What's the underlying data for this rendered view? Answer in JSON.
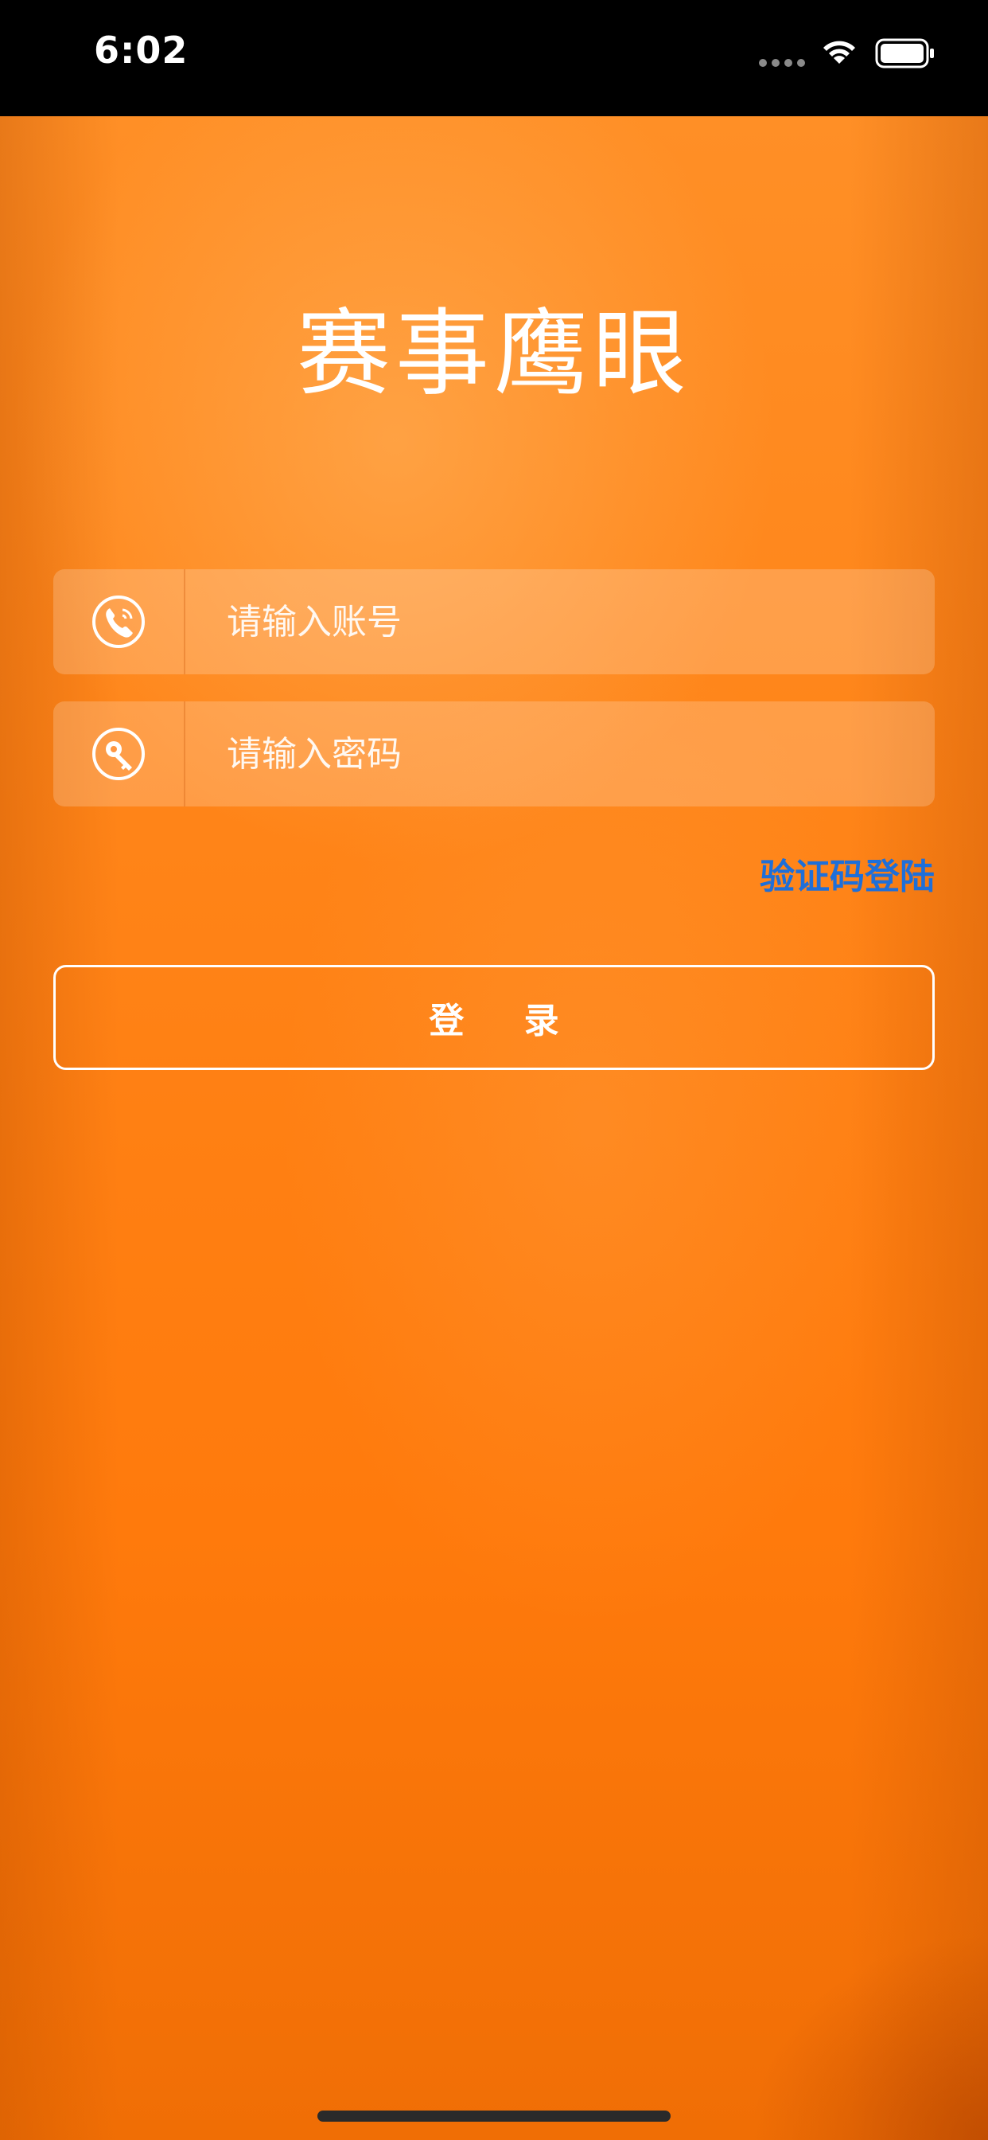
{
  "status_bar": {
    "time": "6:02",
    "icons": [
      "signal-dots-icon",
      "wifi-icon",
      "battery-icon"
    ]
  },
  "app": {
    "title": "赛事鹰眼"
  },
  "form": {
    "account": {
      "icon": "phone-icon",
      "value": "",
      "placeholder": "请输入账号"
    },
    "password": {
      "icon": "key-icon",
      "value": "",
      "placeholder": "请输入密码"
    },
    "sms_login_label": "验证码登陆",
    "login_label": "登 录"
  },
  "colors": {
    "background": "#ff7d0d",
    "link": "#1e6fd9",
    "text": "#ffffff"
  }
}
